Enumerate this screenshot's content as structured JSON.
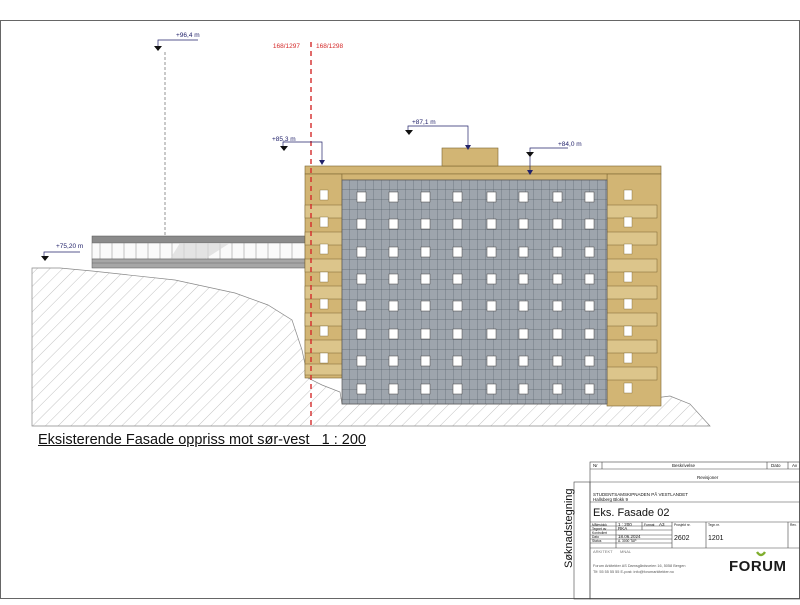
{
  "elevation": {
    "caption": "Eksisterende Fasade oppriss mot sør-vest   1 : 200",
    "levels": {
      "top_left": "+96,4 m",
      "mid": "+85,3 m",
      "roof": "+87,1 m",
      "right": "+84,0 m",
      "ground": "+75,20 m"
    },
    "property_lines": {
      "left": "168/1297",
      "right": "168/1298"
    }
  },
  "title_block": {
    "vertical_label": "Søknadstegning",
    "rev_headers": [
      "Nr",
      "Beskrivelse",
      "Dato",
      "Av"
    ],
    "revisjoner": "Revisjoner",
    "client_line": "STUDENTSAMSKIPNADEN PÅ VESTLANDET",
    "project_line": "Hallsberg Blokk 9",
    "drawing_title": "Eks. Fasade 02",
    "scale_label": "Målestokk",
    "scale": "1 : 200",
    "format_label": "Format",
    "format": "A3",
    "drawn_label": "Tegnet av",
    "drawn": "RKA",
    "checked_label": "Kontrollert",
    "date_label": "Dato",
    "date": "18.06.2024",
    "status_label": "Status",
    "status": "A. 3000 TAP",
    "project_no_label": "Prosjekt nr.",
    "project_no": "2602",
    "drawing_no_label": "Tegn.nr.",
    "drawing_no": "1201",
    "rev_label": "Rev.",
    "architect_label": "ARKITEKT",
    "architect_name": "MNAL",
    "company_line1": "Forum Arkitekter AS   Damsgårdsveien 16, 5058 Bergen",
    "company_line2": "Tlf: 55 55 55 55   E-post: info@forumarkitekter.no",
    "logo": "FORUM"
  },
  "colors": {
    "cladding": "#d2b574",
    "grid_panel": "#9aa1a8",
    "property_line": "#d42a2a",
    "level_marker": "#23236b",
    "terrain_hatch": "#aaaaaa"
  }
}
